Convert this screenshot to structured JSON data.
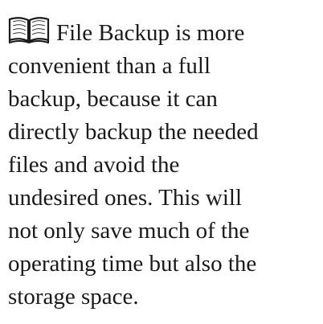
{
  "note": {
    "icon": "open-book-icon",
    "lines": [
      "File Backup is more",
      "convenient than a full",
      "backup, because it can",
      "directly backup the needed",
      "files and avoid the",
      "undesired ones. This will",
      "not only save much of the",
      "operating time but also the",
      "storage space."
    ]
  }
}
